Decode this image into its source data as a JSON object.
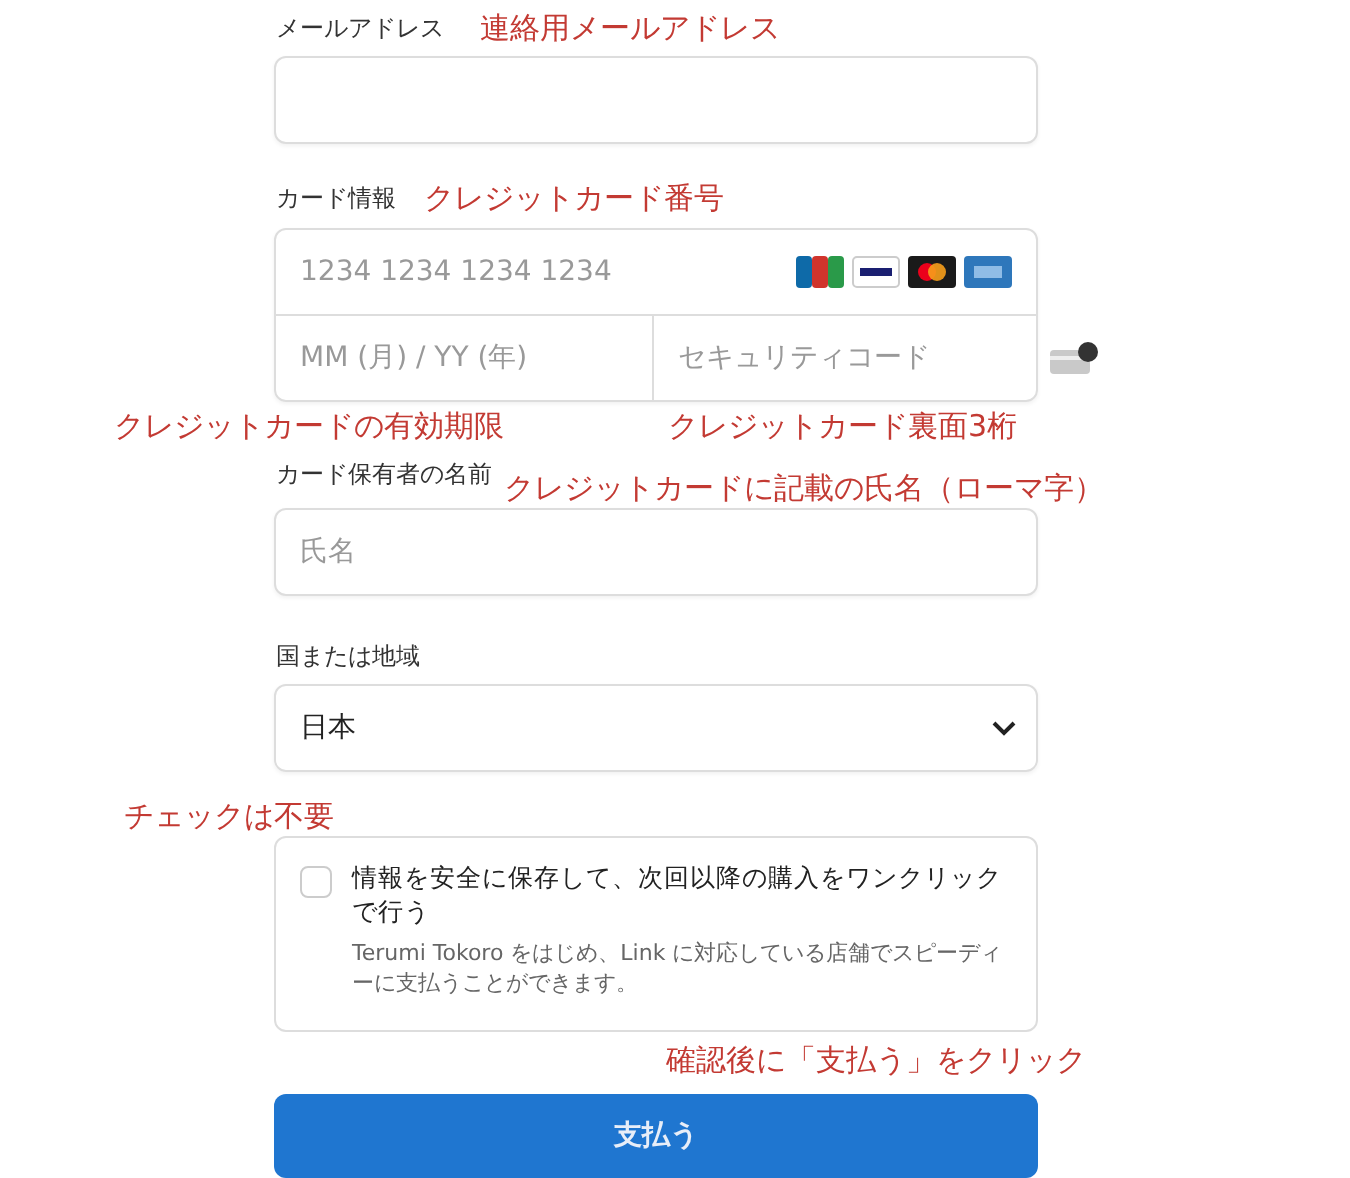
{
  "email": {
    "label": "メールアドレス",
    "note": "連絡用メールアドレス"
  },
  "card": {
    "label": "カード情報",
    "note": "クレジットカード番号",
    "number_placeholder": "1234 1234 1234 1234",
    "brands": [
      {
        "kind": "jcb"
      },
      {
        "kind": "visa"
      },
      {
        "kind": "mastercard"
      },
      {
        "kind": "amex"
      }
    ],
    "expiry_placeholder": "MM (月) / YY (年)",
    "cvc_placeholder": "セキュリティコード",
    "expiry_note": "クレジットカードの有効期限",
    "cvc_note": "クレジットカード裏面3桁"
  },
  "holder": {
    "label": "カード保有者の名前",
    "note": "クレジットカードに記載の氏名（ローマ字）",
    "placeholder": "氏名"
  },
  "country": {
    "label": "国または地域",
    "value": "日本"
  },
  "save": {
    "note": "チェックは不要",
    "checked": false,
    "label": "情報を安全に保存して、次回以降の購入をワンクリックで行う",
    "description": "Terumi Tokoro をはじめ、Link に対応している店舗でスピーディーに支払うことができます。"
  },
  "pay": {
    "note": "確認後に「支払う」をクリック",
    "button": "支払う"
  }
}
